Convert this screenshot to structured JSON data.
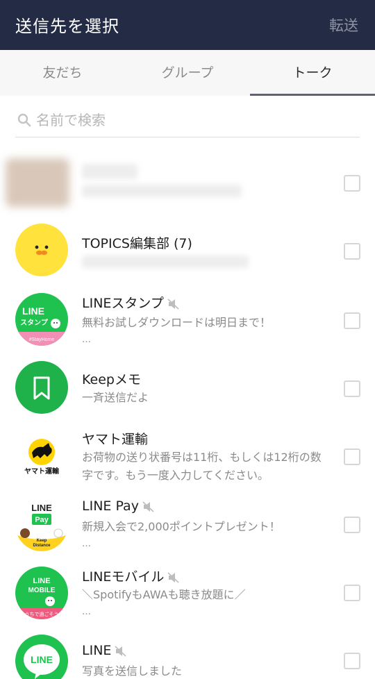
{
  "header": {
    "title": "送信先を選択",
    "action": "転送"
  },
  "tabs": [
    "友だち",
    "グループ",
    "トーク"
  ],
  "search": {
    "placeholder": "名前で検索"
  },
  "chats": [
    {
      "name": "",
      "muted": false,
      "message": "",
      "ellipsis": ""
    },
    {
      "name": "TOPICS編集部 (7)",
      "muted": false,
      "message": "",
      "ellipsis": ""
    },
    {
      "name": "LINEスタンプ",
      "muted": true,
      "message": "無料お試しダウンロードは明日まで！",
      "ellipsis": "…"
    },
    {
      "name": "Keepメモ",
      "muted": false,
      "message": "一斉送信だよ",
      "ellipsis": ""
    },
    {
      "name": "ヤマト運輸",
      "muted": false,
      "message": "お荷物の送り状番号は11桁、もしくは12桁の数字です。もう一度入力してください。",
      "ellipsis": ""
    },
    {
      "name": "LINE Pay",
      "muted": true,
      "message": "新規入会で2,000ポイントプレゼント！",
      "ellipsis": "…"
    },
    {
      "name": "LINEモバイル",
      "muted": true,
      "message": "＼SpotifyもAWAも聴き放題に／",
      "ellipsis": "…"
    },
    {
      "name": "LINE",
      "muted": true,
      "message": "写真を送信しました",
      "ellipsis": ""
    }
  ],
  "avatar_texts": {
    "stamp": [
      "LINE",
      "スタンプ",
      "#StayHome"
    ],
    "yamato": "ヤマト運輸",
    "pay": [
      "LINE",
      "Pay",
      "Keep",
      "Distance"
    ],
    "mobile": [
      "LINE",
      "MOBILE",
      "うちで過ごそう"
    ],
    "line": "LINE"
  },
  "colors": {
    "header_bg": "#232b45",
    "line_green": "#1fc14f",
    "muted_text": "#8a8a8a"
  }
}
